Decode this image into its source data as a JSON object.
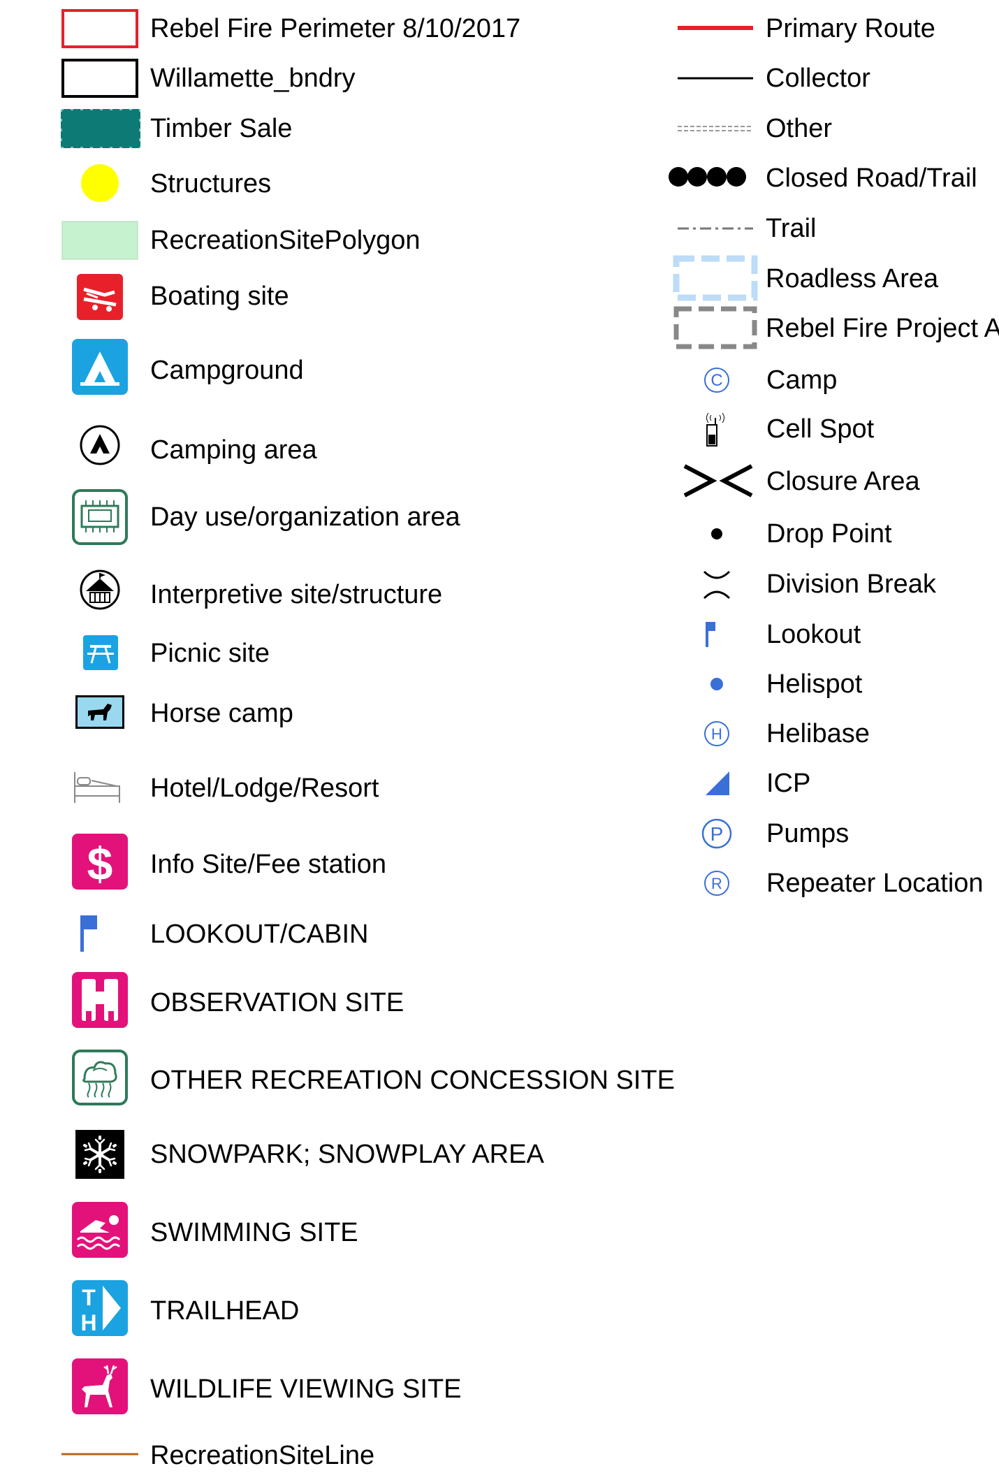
{
  "legend": {
    "left": [
      {
        "label": "Rebel Fire Perimeter 8/10/2017",
        "icon": "fire-perimeter-polygon-icon",
        "color": "#e8202a"
      },
      {
        "label": "Willamette_bndry",
        "icon": "boundary-polygon-icon",
        "color": "#000000"
      },
      {
        "label": "Timber Sale",
        "icon": "timber-sale-polygon-icon",
        "color": "#0d7a76"
      },
      {
        "label": "Structures",
        "icon": "structure-point-icon",
        "color": "#ffff00"
      },
      {
        "label": "RecreationSitePolygon",
        "icon": "recreation-polygon-icon",
        "color": "#c7f2cf"
      },
      {
        "label": "Boating site",
        "icon": "boating-icon",
        "color": "#e8202a"
      },
      {
        "label": "Campground",
        "icon": "campground-icon",
        "color": "#1aa3e0"
      },
      {
        "label": "Camping area",
        "icon": "camping-area-icon",
        "color": "#000000"
      },
      {
        "label": "Day use/organization area",
        "icon": "day-use-icon",
        "color": "#2e7a5a"
      },
      {
        "label": "Interpretive site/structure",
        "icon": "interpretive-icon",
        "color": "#000000"
      },
      {
        "label": "Picnic site",
        "icon": "picnic-icon",
        "color": "#1aa3e0"
      },
      {
        "label": "Horse camp",
        "icon": "horse-camp-icon",
        "color": "#9ad8f0"
      },
      {
        "label": "Hotel/Lodge/Resort",
        "icon": "hotel-bed-icon",
        "color": "#888888"
      },
      {
        "label": "Info Site/Fee station",
        "icon": "fee-station-icon",
        "color": "#e3127a"
      },
      {
        "label": "LOOKOUT/CABIN",
        "icon": "lookout-flag-icon",
        "color": "#3a6fd8"
      },
      {
        "label": "OBSERVATION SITE",
        "icon": "binoculars-icon",
        "color": "#e3127a"
      },
      {
        "label": "OTHER RECREATION CONCESSION SITE",
        "icon": "concession-icon",
        "color": "#2e7a5a"
      },
      {
        "label": "SNOWPARK; SNOWPLAY AREA",
        "icon": "snowflake-icon",
        "color": "#000000"
      },
      {
        "label": "SWIMMING SITE",
        "icon": "swimmer-icon",
        "color": "#e3127a"
      },
      {
        "label": "TRAILHEAD",
        "icon": "trailhead-icon",
        "color": "#1aa3e0"
      },
      {
        "label": "WILDLIFE VIEWING SITE",
        "icon": "deer-icon",
        "color": "#e3127a"
      },
      {
        "label": "RecreationSiteLine",
        "icon": "recreation-line-icon",
        "color": "#b5651d"
      }
    ],
    "right": [
      {
        "label": "Primary Route",
        "icon": "primary-route-line-icon",
        "color": "#e8202a"
      },
      {
        "label": "Collector",
        "icon": "collector-line-icon",
        "color": "#000000"
      },
      {
        "label": "Other",
        "icon": "other-road-line-icon",
        "color": "#999999"
      },
      {
        "label": "Closed Road/Trail",
        "icon": "closed-road-dots-icon",
        "color": "#000000"
      },
      {
        "label": "Trail",
        "icon": "trail-line-icon",
        "color": "#777777"
      },
      {
        "label": "Roadless Area",
        "icon": "roadless-area-icon",
        "color": "#bcdcf7"
      },
      {
        "label": "Rebel Fire Project Ar",
        "icon": "project-area-icon",
        "color": "#888888"
      },
      {
        "label": "Camp",
        "icon": "camp-c-icon",
        "color": "#3a6fd8"
      },
      {
        "label": "Cell Spot",
        "icon": "cell-phone-icon",
        "color": "#000000"
      },
      {
        "label": "Closure Area",
        "icon": "closure-area-icon",
        "color": "#000000"
      },
      {
        "label": "Drop Point",
        "icon": "drop-point-icon",
        "color": "#000000"
      },
      {
        "label": "Division Break",
        "icon": "division-break-icon",
        "color": "#000000"
      },
      {
        "label": "Lookout",
        "icon": "lookout-small-flag-icon",
        "color": "#3a6fd8"
      },
      {
        "label": "Helispot",
        "icon": "helispot-icon",
        "color": "#3a6fd8"
      },
      {
        "label": "Helibase",
        "icon": "helibase-h-icon",
        "color": "#3a6fd8"
      },
      {
        "label": "ICP",
        "icon": "icp-icon",
        "color": "#3a6fd8"
      },
      {
        "label": "Pumps",
        "icon": "pumps-p-icon",
        "color": "#3a6fd8"
      },
      {
        "label": "Repeater Location",
        "icon": "repeater-r-icon",
        "color": "#3a6fd8"
      }
    ]
  }
}
